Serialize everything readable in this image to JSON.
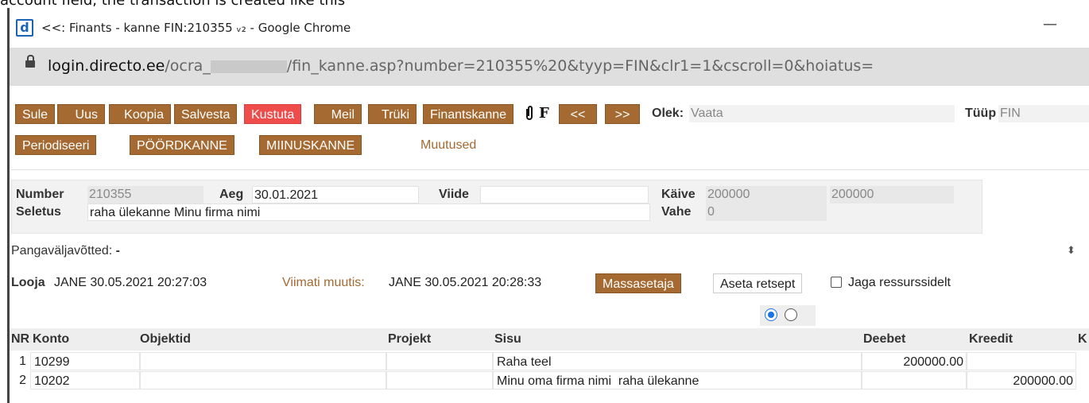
{
  "caption": "account field, the transaction is created like this",
  "window": {
    "title": "<<: Finants - kanne FIN:210355 ᵥ₂ - Google Chrome",
    "app_icon": "d",
    "minimize": "—"
  },
  "url": {
    "host": "login.directo.ee",
    "prefix": "/ocra_",
    "path": "/fin_kanne.asp?number=210355%20&tyyp=FIN&clr1=1&cscroll=0&hoiatus="
  },
  "toolbar": {
    "sule": "Sule",
    "uus": "Uus",
    "koopia": "Koopia",
    "salvesta": "Salvesta",
    "kustuta": "Kustuta",
    "meil": "Meil",
    "truki": "Trüki",
    "finantskanne": "Finantskanne",
    "f": "F",
    "prev": "<<",
    "next": ">>",
    "olek_label": "Olek:",
    "olek_value": "Vaata",
    "tuup_label": "Tüüp",
    "tuup_value": "FIN",
    "periodiseeri": "Periodiseeri",
    "poordkanne": "PÖÖRDKANNE",
    "miinuskanne": "MIINUSKANNE",
    "muutused": "Muutused"
  },
  "header": {
    "number_label": "Number",
    "number": "210355",
    "aeg_label": "Aeg",
    "aeg": "30.01.2021",
    "viide_label": "Viide",
    "viide": "",
    "kaive_label": "Käive",
    "kaive1": "200000",
    "kaive2": "200000",
    "seletus_label": "Seletus",
    "seletus": "raha ülekanne Minu firma nimi",
    "vahe_label": "Vahe",
    "vahe": "0"
  },
  "info": {
    "pangavaljavotted": "Pangaväljavõtted:",
    "pangavaljavotted_value": "-",
    "looja_label": "Looja",
    "looja": "JANE 30.05.2021 20:27:03",
    "viimati_label": "Viimati muutis:",
    "viimati": "JANE 30.05.2021 20:28:33",
    "massasetaja": "Massasetaja",
    "aseta_retsept": "Aseta retsept",
    "jaga_ressurssidelt": "Jaga ressurssidelt"
  },
  "grid": {
    "columns": [
      "NR",
      "Konto",
      "Objektid",
      "Projekt",
      "Sisu",
      "Deebet",
      "Kreedit",
      "K"
    ],
    "rows": [
      {
        "nr": "1",
        "konto": "10299",
        "objektid": "",
        "projekt": "",
        "sisu": "Raha teel",
        "deebet": "200000.00",
        "kreedit": ""
      },
      {
        "nr": "2",
        "konto": "10202",
        "objektid": "",
        "projekt": "",
        "sisu": "Minu oma firma nimi  raha ülekanne",
        "deebet": "",
        "kreedit": "200000.00"
      }
    ]
  },
  "colors": {
    "button": "#a46a32",
    "delete_button": "#ef4c4c",
    "radio_selected": "#1a73e8"
  }
}
